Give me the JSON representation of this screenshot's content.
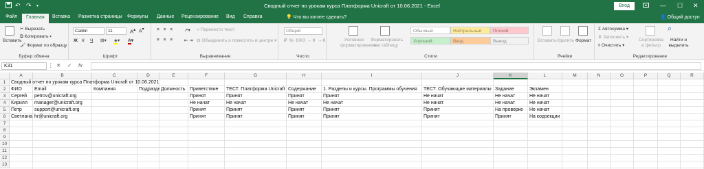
{
  "titlebar": {
    "title": "Сводный отчет по урокам курса Платформа Unicraft от 10.06.2021  -  Excel",
    "signin_label": "Вход",
    "qa_save_icon": "save-icon",
    "qa_undo_icon": "undo-icon",
    "qa_redo_icon": "redo-icon"
  },
  "tabs": [
    {
      "label": "Файл"
    },
    {
      "label": "Главная"
    },
    {
      "label": "Вставка"
    },
    {
      "label": "Разметка страницы"
    },
    {
      "label": "Формулы"
    },
    {
      "label": "Данные"
    },
    {
      "label": "Рецензирование"
    },
    {
      "label": "Вид"
    },
    {
      "label": "Справка"
    }
  ],
  "tellme": "Что вы хотите сделать?",
  "share": "Общий доступ",
  "ribbon": {
    "clipboard": {
      "label": "Буфер обмена",
      "paste": "Вставить",
      "cut": "Вырезать",
      "copy": "Копировать",
      "format_painter": "Формат по образцу"
    },
    "font": {
      "label": "Шрифт",
      "font_name": "Calibri",
      "font_size": "11",
      "bold": "Ж",
      "italic": "К",
      "underline": "Ч"
    },
    "alignment": {
      "label": "Выравнивание",
      "wrap": "Перенести текст",
      "merge": "Объединить и поместить в центре"
    },
    "number": {
      "label": "Число",
      "format": "Общий"
    },
    "styles": {
      "label": "Стили",
      "conditional": "Условное форматирование",
      "as_table": "Форматировать как таблицу",
      "cells": [
        "Обычный",
        "Нейтральный",
        "Плохой",
        "Хороший",
        "Ввод",
        "Вывод"
      ]
    },
    "cells": {
      "label": "Ячейки",
      "insert": "Вставить",
      "delete": "Удалить",
      "format": "Формат"
    },
    "editing": {
      "label": "Редактирование",
      "autosum": "Автосумма",
      "fill": "Заполнить",
      "clear": "Очистить",
      "sort": "Сортировка и фильтр",
      "find": "Найти и выделить"
    }
  },
  "formula_bar": {
    "namebox": "K31",
    "fx": "fx",
    "cancel": "✕",
    "enter": "✓",
    "value": ""
  },
  "columns": [
    "A",
    "B",
    "C",
    "D",
    "E",
    "F",
    "G",
    "H",
    "I",
    "J",
    "K",
    "L",
    "M",
    "N",
    "O",
    "P",
    "Q",
    "R"
  ],
  "selected_column": "K",
  "rows": [
    "1",
    "2",
    "3",
    "4",
    "5",
    "6",
    "7",
    "8",
    "9",
    "10",
    "11",
    "12",
    "13"
  ],
  "sheet": {
    "title": "Сводный отчет по урокам курса Платформа Unicraft от 10.06.2021",
    "headers": [
      "ФИО",
      "Email",
      "Компания",
      "Подразделение",
      "Должность",
      "Приветствие",
      "ТЕСТ. Платформа Unicraft",
      "Содержание",
      "1. Разделы и курсы. Программы обучения",
      "ТЕСТ. Обучающие материалы",
      "Задание",
      "Экзамен"
    ],
    "data": [
      [
        "Сергей",
        "petrov@unicraft.org",
        "",
        "",
        "",
        "Принят",
        "Принят",
        "Принят",
        "Принят",
        "Не начат",
        "Не начат",
        "Не начат"
      ],
      [
        "Кирилл",
        "manager@unicraft.org",
        "",
        "",
        "",
        "Не начат",
        "Не начат",
        "Не начат",
        "Не начат",
        "Не начат",
        "Не начат",
        "Не начат"
      ],
      [
        "Петр",
        "support@unicraft.org",
        "",
        "",
        "",
        "Принят",
        "Принят",
        "Принят",
        "Принят",
        "Принят",
        "На проверке",
        "Не начат"
      ],
      [
        "Светлана",
        "hr@unicraft.org",
        "",
        "",
        "",
        "Принят",
        "Принят",
        "Принят",
        "Принят",
        "Принят",
        "Принят",
        "На коррекции"
      ]
    ]
  },
  "colors": {
    "brand": "#217346",
    "ribbon_bg": "#f3f3f3",
    "neutral_bg": "#ffeb9c",
    "bad_bg": "#ffc7ce",
    "good_bg": "#c6efce",
    "input_bg": "#ffcc99",
    "output_bg": "#f2f2f2"
  }
}
